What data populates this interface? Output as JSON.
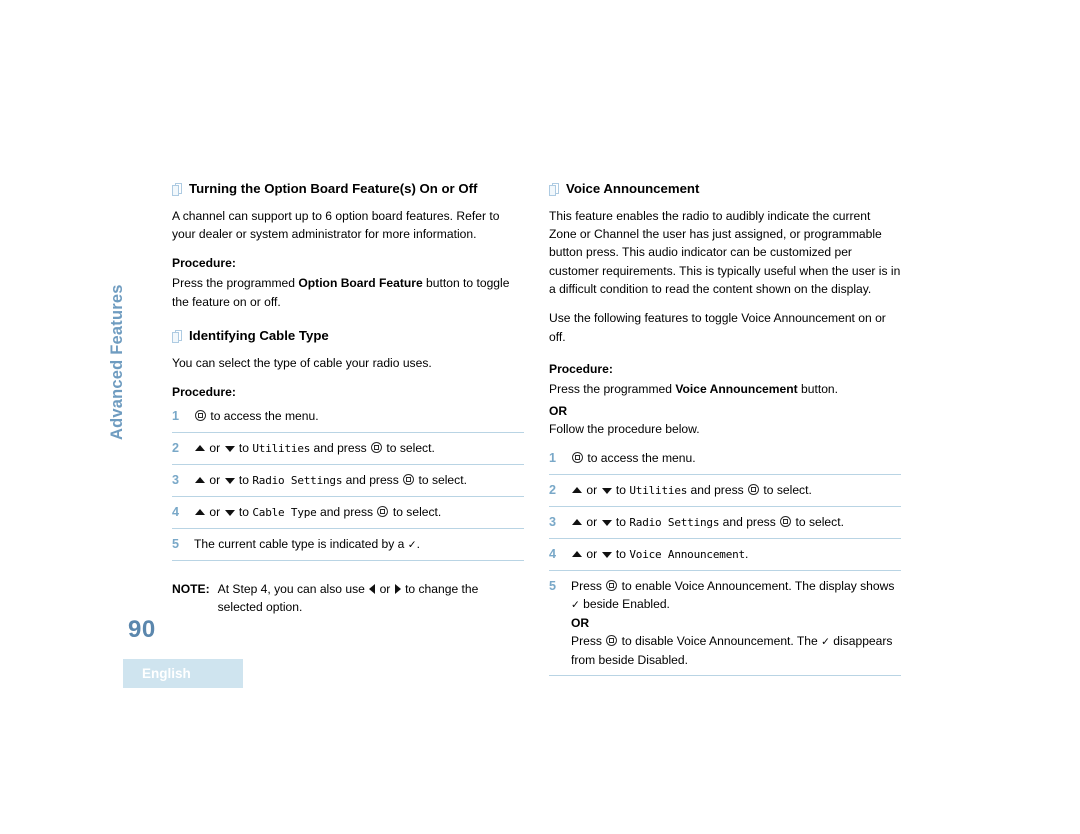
{
  "page": {
    "number": "90",
    "language_badge": "English",
    "chapter_tab": "Advanced Features",
    "accent_color": "#79a8c8",
    "rule_color": "#b9d4e4",
    "page_number_color": "#5b87ad",
    "badge_bg_color": "#cfe4ef"
  },
  "left_column": {
    "section_1": {
      "heading": "Turning the Option Board Feature(s) On or Off",
      "intro": "A channel can support up to 6 option board features. Refer to your dealer or system administrator for more information.",
      "procedure_label": "Procedure:",
      "procedure_pre": "Press the programmed ",
      "procedure_bold": "Option Board Feature",
      "procedure_post": " button to toggle the feature on or off."
    },
    "section_2": {
      "heading": "Identifying Cable Type",
      "intro": "You can select the type of cable your radio uses.",
      "procedure_label": "Procedure:",
      "steps": [
        {
          "number": "1",
          "icons": [
            "menu-button-icon"
          ],
          "text_after": " to access the menu."
        },
        {
          "number": "2",
          "prefix": "",
          "or_text": "or",
          "to_text": "to",
          "menu_item": "Utilities",
          "and_press": "and press",
          "suffix": "to select."
        },
        {
          "number": "3",
          "or_text": "or",
          "to_text": "to",
          "menu_item": "Radio Settings",
          "and_press": "and press",
          "suffix": "to select."
        },
        {
          "number": "4",
          "or_text": "or",
          "to_text": "to",
          "menu_item": "Cable Type",
          "and_press": "and press",
          "suffix": "to select."
        },
        {
          "number": "5",
          "plain_pre": "The current cable type is indicated by a ",
          "check": "✓",
          "plain_post": "."
        }
      ],
      "note": {
        "label": "NOTE:",
        "pre": "At Step 4, you can also use ",
        "mid": " or ",
        "post": " to change the selected option."
      }
    }
  },
  "right_column": {
    "section_1": {
      "heading": "Voice Announcement",
      "intro_1": "This feature enables the radio to audibly indicate the current Zone or Channel the user has just assigned, or programmable button press. This audio indicator can be customized per customer requirements. This is typically useful when the user is in a difficult condition to read the content shown on the display.",
      "intro_2": "Use the following features to toggle Voice Announcement on or off.",
      "procedure_label": "Procedure:",
      "procedure_pre": "Press the programmed ",
      "procedure_bold": "Voice Announcement",
      "procedure_post": " button.",
      "or_label": "OR",
      "procedure_follow": "Follow the procedure below.",
      "steps": [
        {
          "number": "1",
          "text_after": " to access the menu."
        },
        {
          "number": "2",
          "or_text": "or",
          "to_text": "to",
          "menu_item": "Utilities",
          "and_press": "and press",
          "suffix": "to select."
        },
        {
          "number": "3",
          "or_text": "or",
          "to_text": "to",
          "menu_item": "Radio Settings",
          "and_press": "and press",
          "suffix": "to select."
        },
        {
          "number": "4",
          "or_text": "or",
          "to_text": "to",
          "menu_item": "Voice Announcement",
          "suffix": "."
        },
        {
          "number": "5",
          "press_1_pre": "Press ",
          "press_1_post": " to enable Voice Announcement. The display shows ",
          "check_1": "✓",
          "press_1_end": " beside Enabled.",
          "or_label": "OR",
          "press_2_pre": "Press ",
          "press_2_post": " to disable Voice Announcement. The ",
          "check_2": "✓",
          "press_2_end": " disappears from beside Disabled."
        }
      ]
    }
  }
}
